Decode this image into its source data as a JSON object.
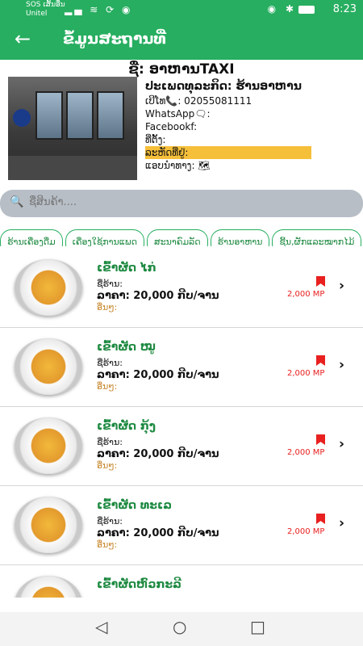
{
  "status_bar": {
    "carrier_line1": "SOS ເສັ້ນອື່ນ",
    "carrier_line2": "Unitel",
    "time": "8:23"
  },
  "app_bar": {
    "title": "ຂໍ້ມູນສະຖານທີ່"
  },
  "store": {
    "name": "ຊື່: ອາຫານTAXI",
    "type": "ປະເພດທຸລະກິດ: ຮ້ານອາຫານ",
    "phone": "ເບີໂທ📞: 02055081111",
    "whatsapp": "WhatsApp🗨:",
    "facebook": "Facebookf:",
    "location": "ທີ່ຕັ້ງ:",
    "hours": "ລະຫັດທີ່ຢູ່:",
    "map": "ແອບນຳທາງ: 🗺"
  },
  "search": {
    "placeholder": "ຊື່ສິນຄ້າ...."
  },
  "categories": [
    "ຮ້ານເຄື່ອງດື່ມ",
    "ເຄື່ອງໃຊ້ການແພດ",
    "ສະນາຄົມລັດ",
    "ຮ້ານອາຫານ",
    "ຊີ້ນ,ຜັກແລະໝາກໄມ້"
  ],
  "items": [
    {
      "name": "ເຂົ້າຜັດ ໄກ່",
      "shop": "ຊື່ຮ້ານ:",
      "price": "ລາຄາ:  20,000 ກີບ/ຈານ",
      "note": "ອື່ນໆ:",
      "mp": "2,000 MP"
    },
    {
      "name": "ເຂົ້າຜັດ ໝູ",
      "shop": "ຊື່ຮ້ານ:",
      "price": "ລາຄາ:  20,000 ກີບ/ຈານ",
      "note": "ອື່ນໆ:",
      "mp": "2,000 MP"
    },
    {
      "name": "ເຂົ້າຜັດ ກຸ້ງ",
      "shop": "ຊື່ຮ້ານ:",
      "price": "ລາຄາ:  20,000 ກີບ/ຈານ",
      "note": "ອື່ນໆ:",
      "mp": "2,000 MP"
    },
    {
      "name": "ເຂົ້າຜັດ ທະເລ",
      "shop": "ຊື່ຮ້ານ:",
      "price": "ລາຄາ:  20,000 ກີບ/ຈານ",
      "note": "ອື່ນໆ:",
      "mp": "2,000 MP"
    },
    {
      "name": "ເຂົ້າຜັດຫົວກະລີ",
      "shop": "",
      "price": "",
      "note": "",
      "mp": ""
    }
  ],
  "colors": {
    "primary": "#27ae60",
    "highlight": "#f6bf3a",
    "accent_red": "#e8201f"
  }
}
